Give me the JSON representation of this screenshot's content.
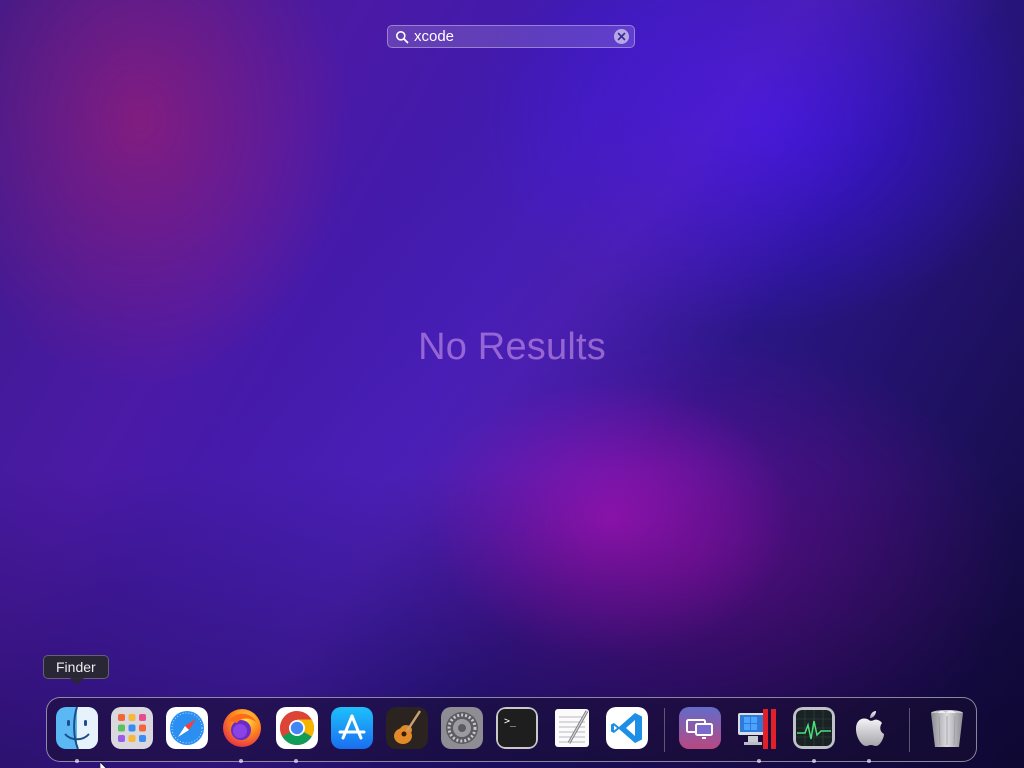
{
  "search": {
    "query": "xcode",
    "icon": "magnifying-glass-icon",
    "clear_icon": "clear-x-icon"
  },
  "message": "No Results",
  "tooltip": "Finder",
  "colors": {
    "accent_message": "#c890e6",
    "dock_border": "#ffffff",
    "code_blue": "#1e8fe6"
  },
  "dock": {
    "apps": [
      {
        "name": "Finder",
        "icon": "finder-icon",
        "running": true
      },
      {
        "name": "Launchpad",
        "icon": "launchpad-icon",
        "running": false
      },
      {
        "name": "Safari",
        "icon": "safari-icon",
        "running": false
      },
      {
        "name": "Firefox",
        "icon": "firefox-icon",
        "running": true
      },
      {
        "name": "Chrome",
        "icon": "chrome-icon",
        "running": true
      },
      {
        "name": "App Store",
        "icon": "app-store-icon",
        "running": false
      },
      {
        "name": "GarageBand",
        "icon": "garageband-icon",
        "running": false
      },
      {
        "name": "System Preferences",
        "icon": "system-preferences-icon",
        "running": false
      },
      {
        "name": "Terminal",
        "icon": "terminal-icon",
        "running": false
      },
      {
        "name": "TextEdit",
        "icon": "textedit-icon",
        "running": false
      },
      {
        "name": "Visual Studio Code",
        "icon": "vscode-icon",
        "running": false
      }
    ],
    "extras": [
      {
        "name": "Screen Sharing",
        "icon": "screen-sharing-icon",
        "running": false
      },
      {
        "name": "Parallels Desktop",
        "icon": "parallels-icon",
        "running": true
      },
      {
        "name": "Activity Monitor",
        "icon": "activity-monitor-icon",
        "running": true
      },
      {
        "name": "Apple",
        "icon": "apple-logo-icon",
        "running": true
      }
    ],
    "trash": {
      "name": "Trash",
      "icon": "trash-icon"
    }
  }
}
